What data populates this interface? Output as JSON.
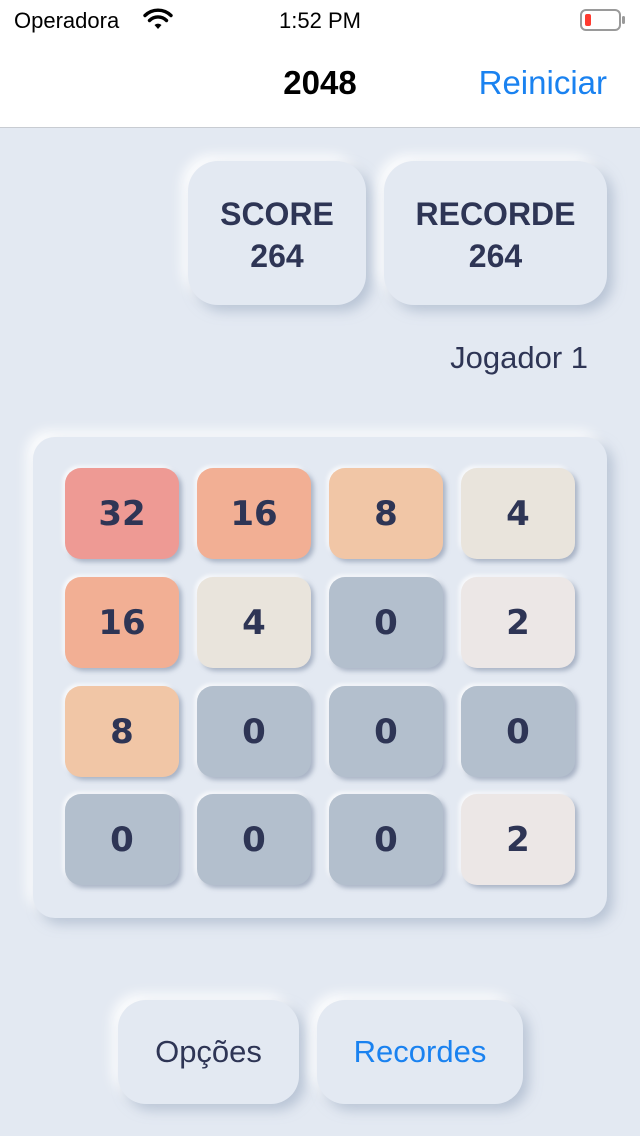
{
  "status_bar": {
    "carrier": "Operadora",
    "time": "1:52 PM",
    "wifi_icon": "wifi-icon",
    "battery_icon": "battery-low-icon"
  },
  "nav": {
    "title": "2048",
    "action": "Reiniciar",
    "accent": "#1a82f0"
  },
  "scores": {
    "score_label": "SCORE",
    "score_value": "264",
    "record_label": "RECORDE",
    "record_value": "264"
  },
  "player": "Jogador 1",
  "board": {
    "tiles": [
      [
        "32",
        "16",
        "8",
        "4"
      ],
      [
        "16",
        "4",
        "0",
        "2"
      ],
      [
        "8",
        "0",
        "0",
        "0"
      ],
      [
        "0",
        "0",
        "0",
        "2"
      ]
    ],
    "colors": {
      "0": "#b3bfcd",
      "2": "#ece7e6",
      "4": "#e9e4dc",
      "8": "#f1c6a6",
      "16": "#f2af94",
      "32": "#ee9a94"
    }
  },
  "buttons": {
    "options": "Opções",
    "records": "Recordes"
  }
}
